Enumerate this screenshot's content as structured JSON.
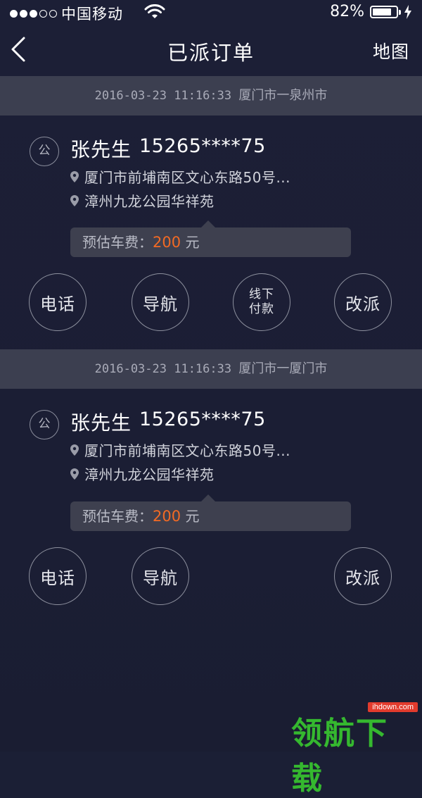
{
  "status_bar": {
    "carrier": "中国移动",
    "battery_percent": "82%",
    "battery_level": 0.82,
    "signal_bars_filled": 3,
    "signal_bars_total": 5
  },
  "nav": {
    "title": "已派订单",
    "right_label": "地图",
    "back_icon": "chevron-left-icon"
  },
  "orders": [
    {
      "datetime": "2016-03-23  11:16:33",
      "route": "厦门市一泉州市",
      "badge": "公",
      "name": "张先生",
      "phone": "15265****75",
      "from_address": "厦门市前埔南区文心东路50号...",
      "to_address": "漳州九龙公园华祥苑",
      "fare_label": "预估车费：",
      "fare_amount": "200",
      "fare_unit": "元",
      "buttons": {
        "call": "电话",
        "navigate": "导航",
        "offline_pay": "线下\n付款",
        "reassign": "改派"
      }
    },
    {
      "datetime": "2016-03-23  11:16:33",
      "route": "厦门市一厦门市",
      "badge": "公",
      "name": "张先生",
      "phone": "15265****75",
      "from_address": "厦门市前埔南区文心东路50号...",
      "to_address": "漳州九龙公园华祥苑",
      "fare_label": "预估车费：",
      "fare_amount": "200",
      "fare_unit": "元",
      "buttons": {
        "call": "电话",
        "navigate": "导航",
        "reassign": "改派"
      }
    }
  ],
  "watermark": {
    "site": "ihdown.com",
    "text": "领航下载"
  },
  "colors": {
    "background": "#1b1f35",
    "date_bar": "#3c3f50",
    "fare_box": "#3e404f",
    "fare_amount": "#f26a24",
    "watermark_green": "#35b82f"
  }
}
